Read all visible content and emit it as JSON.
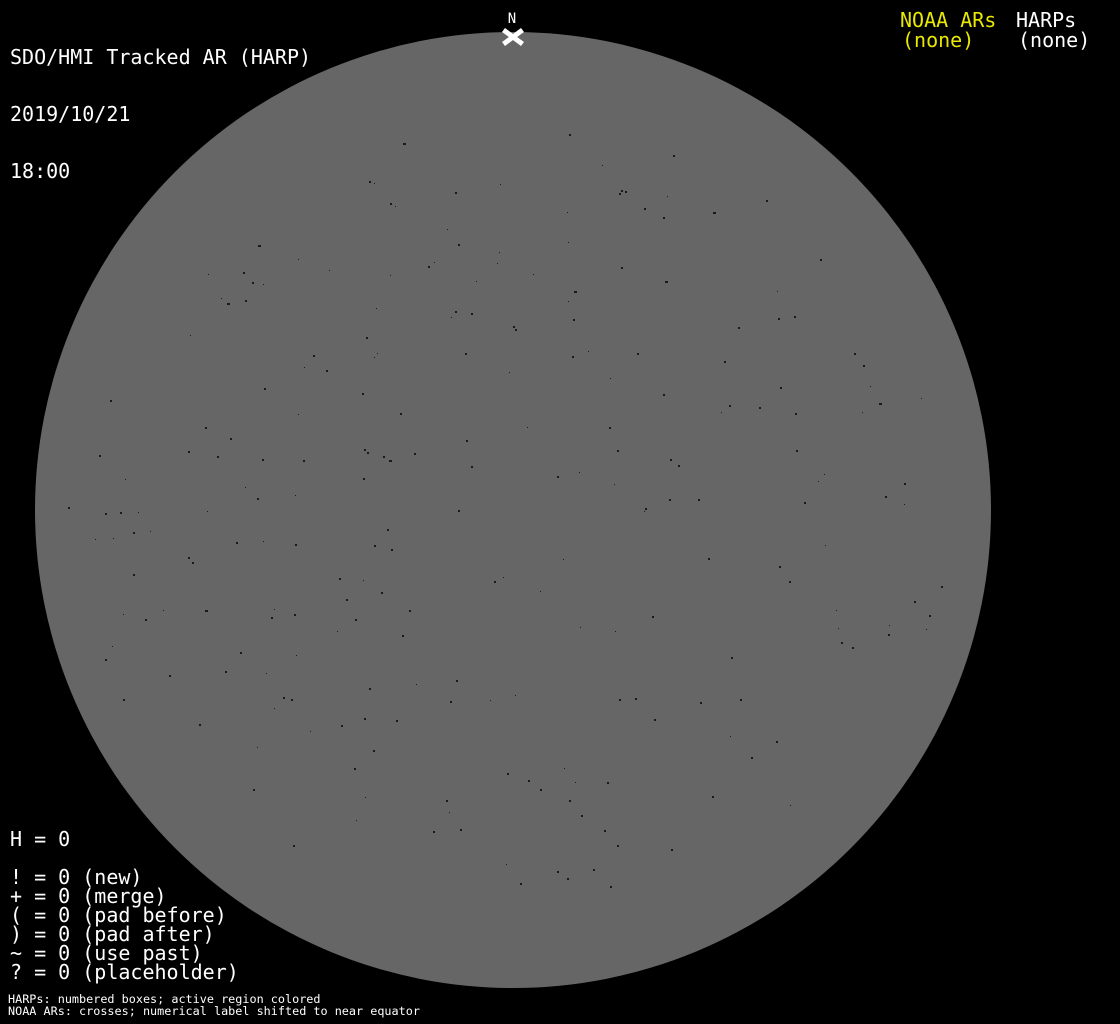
{
  "header": {
    "title": "SDO/HMI Tracked AR (HARP)",
    "date": "2019/10/21",
    "time": "18:00",
    "noaa_ars_label": "NOAA ARs",
    "noaa_ars_value": "(none)",
    "harps_label": "HARPs",
    "harps_value": "(none)"
  },
  "colors": {
    "background": "#000000",
    "disk": "#666666",
    "speck": "#1a1a1a",
    "noaa_accent": "#e8e800",
    "text": "#ffffff"
  },
  "sun_disk": {
    "north_label": "N",
    "north_marker_icon": "x-cross-icon",
    "specks": {
      "description": "scattered dark magnetogram specks on solar disk",
      "count": 240,
      "seed": 20191021,
      "radial_fraction": 0.94,
      "vertical_squash": 0.86
    }
  },
  "legend": {
    "lines": [
      "H = 0",
      "",
      "! = 0 (new)",
      "+ = 0 (merge)",
      "( = 0 (pad before)",
      ") = 0 (pad after)",
      "~ = 0 (use past)",
      "? = 0 (placeholder)"
    ]
  },
  "footnotes": {
    "line1": "HARPs: numbered boxes; active region colored",
    "line2": "NOAA ARs: crosses; numerical label shifted to near equator"
  }
}
